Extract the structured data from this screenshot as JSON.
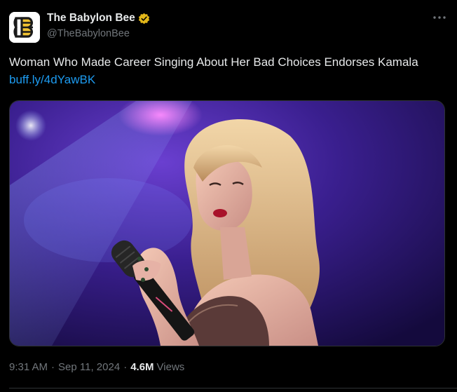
{
  "author": {
    "display_name": "The Babylon Bee",
    "handle": "@TheBabylonBee",
    "avatar_icon": "babylon-bee-logo-icon",
    "verified_icon": "gold-verified-badge-icon",
    "verified_color": "#e2b719"
  },
  "tweet": {
    "text": "Woman Who Made Career Singing About Her Bad Choices Endorses Kamala",
    "link": "buff.ly/4dYawBK"
  },
  "meta": {
    "time": "9:31 AM",
    "date": "Sep 11, 2024",
    "separator": "·",
    "views_count": "4.6M",
    "views_label": "Views"
  },
  "colors": {
    "background": "#000000",
    "text": "#e7e9ea",
    "muted": "#71767b",
    "link": "#1d9bf0"
  }
}
